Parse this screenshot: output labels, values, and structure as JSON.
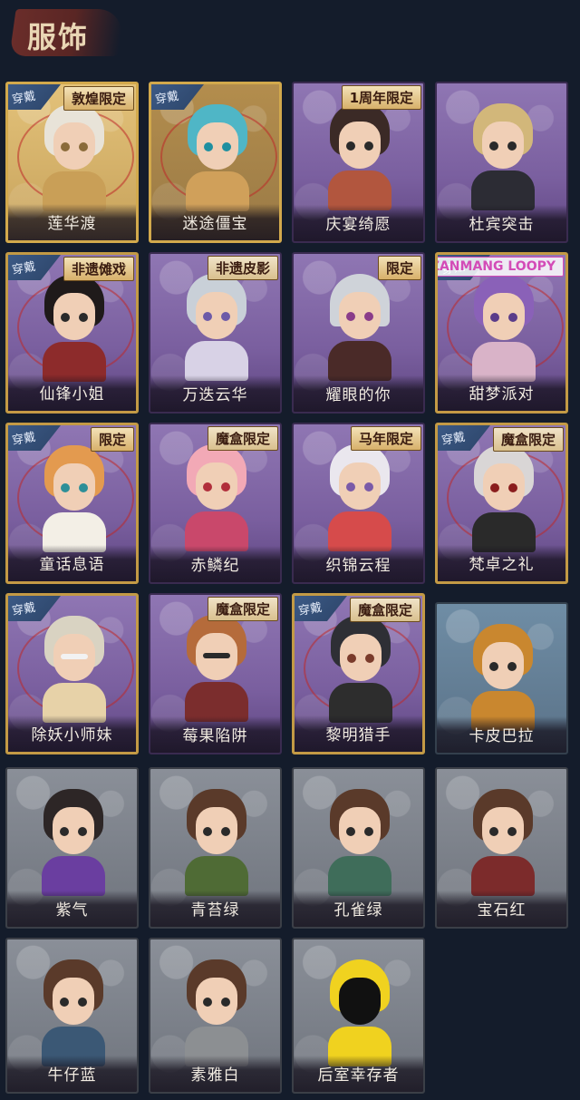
{
  "header": {
    "title": "服饰"
  },
  "labels": {
    "wear": "穿戴"
  },
  "costumes": [
    {
      "name": "莲华渡",
      "tag": "敦煌限定",
      "worn": true
    },
    {
      "name": "迷途僵宝",
      "tag": "",
      "worn": true
    },
    {
      "name": "庆宴绮愿",
      "tag": "1周年限定",
      "worn": false
    },
    {
      "name": "杜宾突击",
      "tag": "",
      "worn": false
    },
    {
      "name": "仙锋小姐",
      "tag": "非遗傩戏",
      "worn": true
    },
    {
      "name": "万迭云华",
      "tag": "非遗皮影",
      "worn": false
    },
    {
      "name": "耀眼的你",
      "tag": "限定",
      "worn": false
    },
    {
      "name": "甜梦派对",
      "tag": "ZANMANG LOOPY",
      "worn": true
    },
    {
      "name": "童话息语",
      "tag": "限定",
      "worn": true
    },
    {
      "name": "赤鳞纪",
      "tag": "魔盒限定",
      "worn": false
    },
    {
      "name": "织锦云程",
      "tag": "马年限定",
      "worn": false
    },
    {
      "name": "梵卓之礼",
      "tag": "魔盒限定",
      "worn": true
    },
    {
      "name": "除妖小师妹",
      "tag": "",
      "worn": true
    },
    {
      "name": "莓果陷阱",
      "tag": "魔盒限定",
      "worn": false
    },
    {
      "name": "黎明猎手",
      "tag": "魔盒限定",
      "worn": true
    },
    {
      "name": "卡皮巴拉",
      "tag": "",
      "worn": false
    },
    {
      "name": "紫气",
      "tag": "",
      "worn": false
    },
    {
      "name": "青苔绿",
      "tag": "",
      "worn": false
    },
    {
      "name": "孔雀绿",
      "tag": "",
      "worn": false
    },
    {
      "name": "宝石红",
      "tag": "",
      "worn": false
    },
    {
      "name": "牛仔蓝",
      "tag": "",
      "worn": false
    },
    {
      "name": "素雅白",
      "tag": "",
      "worn": false
    },
    {
      "name": "后室幸存者",
      "tag": "",
      "worn": false
    }
  ]
}
